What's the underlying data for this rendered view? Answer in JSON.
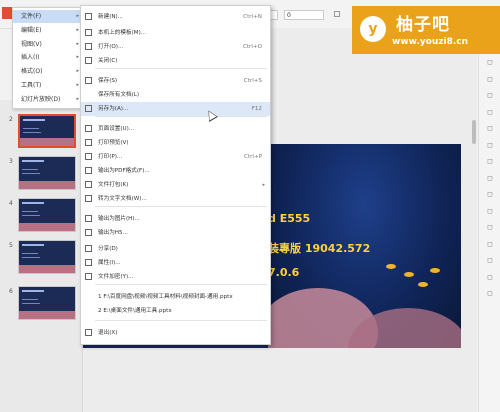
{
  "toolbar": {
    "font_size_value": "0",
    "fields": [
      "",
      "0"
    ]
  },
  "logo": {
    "circle_letter": "y",
    "title": "柚子吧",
    "url": "www.youzi8.cn"
  },
  "file_button": {
    "label": "文件"
  },
  "menu_level1": [
    {
      "label": "文件(F)",
      "active": true
    },
    {
      "label": "编辑(E)"
    },
    {
      "label": "视图(V)"
    },
    {
      "label": "插入(I)"
    },
    {
      "label": "格式(O)"
    },
    {
      "label": "工具(T)"
    },
    {
      "label": "幻灯片放映(D)"
    }
  ],
  "menu_file": {
    "items": [
      {
        "label": "新建(N)...",
        "shortcut": "Ctrl+N",
        "icon": "new-file-icon"
      },
      {
        "label": "本机上的模板(M)...",
        "shortcut": "",
        "icon": "template-icon"
      },
      {
        "label": "打开(O)...",
        "shortcut": "Ctrl+O",
        "icon": "open-folder-icon"
      },
      {
        "label": "关闭(C)",
        "shortcut": "",
        "icon": "close-doc-icon"
      },
      {
        "label": "保存(S)",
        "shortcut": "Ctrl+S",
        "icon": "save-icon"
      },
      {
        "label": "保存所有文档(L)",
        "shortcut": "",
        "icon": ""
      },
      {
        "label": "另存为(A)...",
        "shortcut": "F12",
        "icon": "save-as-icon",
        "highlighted": true
      },
      {
        "label": "页面设置(U)...",
        "shortcut": "",
        "icon": "page-setup-icon"
      },
      {
        "label": "打印预览(V)",
        "shortcut": "",
        "icon": "print-preview-icon"
      },
      {
        "label": "打印(P)...",
        "shortcut": "Ctrl+P",
        "icon": "print-icon"
      },
      {
        "label": "输出为PDF格式(F)...",
        "shortcut": "",
        "icon": "pdf-icon"
      },
      {
        "label": "文件打包(K)",
        "shortcut": "",
        "icon": "package-icon",
        "submenu": true
      },
      {
        "label": "转为文字文档(W)...",
        "shortcut": "",
        "icon": "convert-icon"
      },
      {
        "label": "输出为图片(H)...",
        "shortcut": "",
        "icon": "image-export-icon"
      },
      {
        "label": "输出为H5...",
        "shortcut": "",
        "icon": "h5-icon"
      },
      {
        "label": "分享(D)",
        "shortcut": "",
        "icon": "share-icon"
      },
      {
        "label": "属性(I)...",
        "shortcut": "",
        "icon": "properties-icon"
      },
      {
        "label": "文件加密(Y)...",
        "shortcut": "",
        "icon": "encrypt-icon"
      },
      {
        "label": "1 F:\\百度网盘\\视频\\视频工具材料\\视频封面-通用.pptx",
        "shortcut": "",
        "icon": ""
      },
      {
        "label": "2 E:\\桌面文件\\通用工具.pptx",
        "shortcut": "",
        "icon": ""
      },
      {
        "label": "退出(X)",
        "shortcut": "",
        "icon": "exit-icon"
      }
    ]
  },
  "slides_panel": {
    "slides": [
      {
        "number": "2",
        "selected": true
      },
      {
        "number": "3"
      },
      {
        "number": "4"
      },
      {
        "number": "5"
      },
      {
        "number": "6"
      }
    ]
  },
  "slide": {
    "line1": "d E555",
    "line2": "装專版 19042.572",
    "line3": "7.0.6"
  }
}
